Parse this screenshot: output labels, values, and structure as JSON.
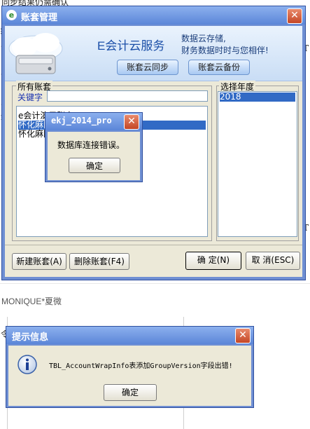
{
  "background": {
    "top_text": "同步结果仍需确认",
    "side_chars": [
      "绍",
      "言",
      "十",
      "斗",
      "叙",
      "令"
    ],
    "right_chars": [
      "T",
      "T"
    ],
    "caption": "MONIQUE*夏微"
  },
  "main_window": {
    "title": "账套管理",
    "banner": {
      "service_name": "E会计云服务",
      "tagline_line1": "数据云存储,",
      "tagline_line2": "财务数据时时与您相伴!",
      "sync_button": "账套云同步",
      "backup_button": "账套云备份"
    },
    "accounts_group": {
      "label": "所有账套",
      "keyword_label": "关键字",
      "keyword_value": "",
      "items": [
        {
          "text": "e会计演示账套",
          "selected": false
        },
        {
          "text": "怀化麻阳",
          "selected": true
        },
        {
          "text": "怀化麻阳",
          "selected": false
        }
      ]
    },
    "year_group": {
      "label": "选择年度",
      "items": [
        {
          "text": "2018",
          "selected": true
        }
      ]
    },
    "buttons": {
      "new": "新建账套(A)",
      "delete": "删除账套(F4)",
      "ok": "确 定(N)",
      "cancel": "取 消(ESC)"
    }
  },
  "error_dialog": {
    "title": "ekj_2014_pro",
    "message": "数据库连接错误。",
    "ok_button": "确定"
  },
  "info_dialog": {
    "title": "提示信息",
    "message": "TBL_AccountWrapInfo表添加GroupVersion字段出错!",
    "ok_button": "确定"
  },
  "colors": {
    "title_bar": "#5b86d8",
    "window_face": "#ece9d8",
    "selection": "#316ac5",
    "close_button": "#c44625"
  }
}
